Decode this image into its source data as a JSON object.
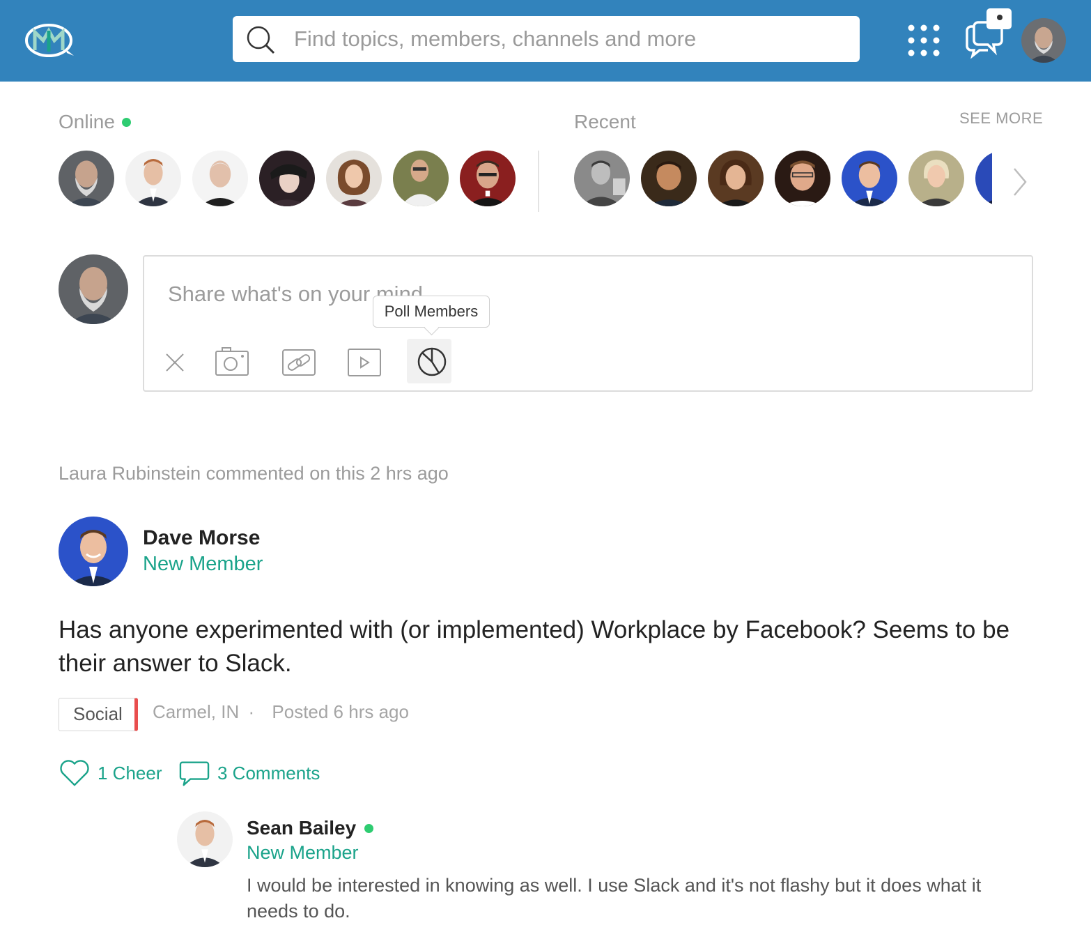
{
  "header": {
    "search_placeholder": "Find topics, members, channels and more",
    "brand_color": "#3283bc"
  },
  "online": {
    "label": "Online",
    "count": 7
  },
  "recent": {
    "label": "Recent",
    "see_more": "SEE MORE"
  },
  "composer": {
    "placeholder": "Share what's on your mind",
    "tooltip": "Poll Members",
    "tools": [
      "close-icon",
      "camera-icon",
      "link-icon",
      "video-icon",
      "poll-icon"
    ]
  },
  "activity": {
    "text": "Laura Rubinstein commented on this 2 hrs ago"
  },
  "post": {
    "author": "Dave Morse",
    "role": "New Member",
    "body": "Has anyone experimented with (or implemented) Workplace by Facebook? Seems to be their answer to Slack.",
    "tag": "Social",
    "location": "Carmel, IN",
    "separator": "·",
    "posted": "Posted 6 hrs ago",
    "cheers": "1 Cheer",
    "comments": "3 Comments"
  },
  "comment": {
    "author": "Sean Bailey",
    "role": "New Member",
    "body": "I would be interested in knowing as well. I use Slack and it's not flashy but it does what it needs to do."
  },
  "colors": {
    "accent_green": "#1aa38a",
    "online_green": "#2ecc71",
    "tag_red": "#e94e4e"
  }
}
